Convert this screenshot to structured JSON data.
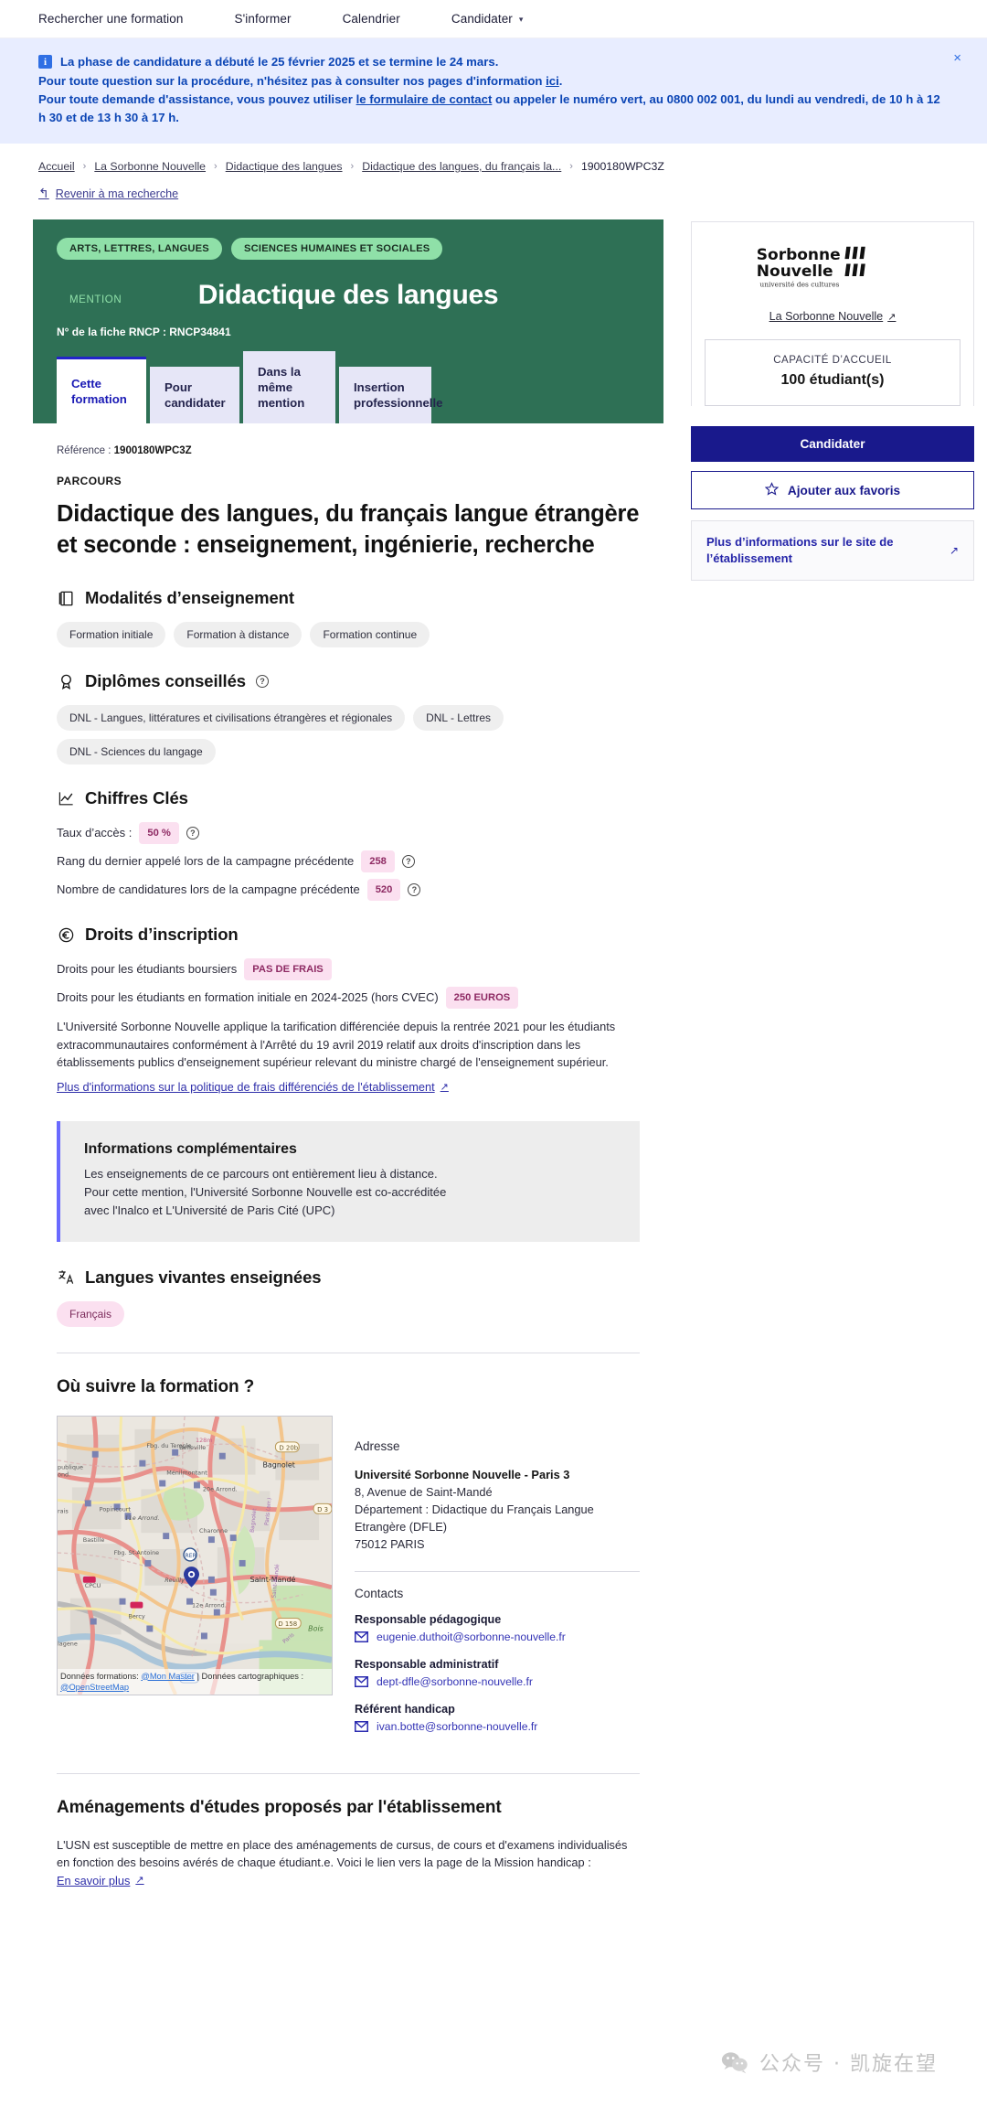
{
  "topnav": {
    "items": [
      {
        "label": "Rechercher une formation",
        "has_caret": false
      },
      {
        "label": "S'informer",
        "has_caret": false
      },
      {
        "label": "Calendrier",
        "has_caret": false
      },
      {
        "label": "Candidater",
        "has_caret": true
      }
    ]
  },
  "banner": {
    "line1": "La phase de candidature a débuté le 25 février 2025 et se termine le 24 mars.",
    "line2_before": "Pour toute question sur la procédure, n'hésitez pas à consulter nos pages d'information ",
    "line2_link": "ici",
    "line2_after": ".",
    "line3_before": "Pour toute demande d'assistance, vous pouvez utiliser ",
    "line3_link": "le formulaire de contact",
    "line3_after": " ou appeler le numéro vert, au 0800 002 001, du lundi au vendredi, de 10 h à 12 h 30 et de 13 h 30 à 17 h.",
    "close_label": "×"
  },
  "breadcrumb": {
    "items": [
      "Accueil",
      "La Sorbonne Nouvelle",
      "Didactique des langues",
      "Didactique des langues, du français la..."
    ],
    "current": "1900180WPC3Z",
    "separator": "›"
  },
  "back": {
    "label": "Revenir à ma recherche",
    "icon": "↰"
  },
  "hero": {
    "tags": [
      "ARTS, LETTRES, LANGUES",
      "SCIENCES HUMAINES ET SOCIALES"
    ],
    "mention_label": "MENTION",
    "title": "Didactique des langues",
    "rncp": "N° de la fiche RNCP : RNCP34841",
    "tabs": [
      {
        "label": "Cette formation",
        "active": true
      },
      {
        "label": "Pour candidater",
        "active": false
      },
      {
        "label": "Dans la même mention",
        "active": false
      },
      {
        "label": "Insertion professionnelle",
        "active": false
      }
    ]
  },
  "main": {
    "reference_label": "Référence : ",
    "reference_value": "1900180WPC3Z",
    "parcours_label": "PARCOURS",
    "course_title": "Didactique des langues, du français langue étrangère et seconde : enseignement, ingénierie, recherche",
    "modalites": {
      "heading": "Modalités d’enseignement",
      "chips": [
        "Formation initiale",
        "Formation à distance",
        "Formation continue"
      ]
    },
    "diplomes": {
      "heading": "Diplômes conseillés",
      "chips": [
        "DNL - Langues, littératures et civilisations étrangères et régionales",
        "DNL - Lettres",
        "DNL - Sciences du langage"
      ]
    },
    "chiffres": {
      "heading": "Chiffres Clés",
      "rows": [
        {
          "label": "Taux d’accès :",
          "value": "50 %"
        },
        {
          "label": "Rang du dernier appelé lors de la campagne précédente",
          "value": "258"
        },
        {
          "label": "Nombre de candidatures lors de la campagne précédente",
          "value": "520"
        }
      ]
    },
    "droits": {
      "heading": "Droits d’inscription",
      "rows": [
        {
          "label": "Droits pour les étudiants boursiers",
          "value": "PAS DE FRAIS"
        },
        {
          "label": "Droits pour les étudiants en formation initiale en 2024-2025 (hors CVEC)",
          "value": "250 EUROS"
        }
      ],
      "paragraph": "L'Université Sorbonne Nouvelle applique la tarification différenciée depuis la rentrée 2021 pour les étudiants extracommunautaires conformément à l'Arrêté du 19 avril 2019 relatif aux droits d'inscription dans les établissements publics d'enseignement supérieur relevant du ministre chargé de l'enseignement supérieur.",
      "link": "Plus d'informations sur la politique de frais différenciés de l'établissement"
    },
    "callout": {
      "title": "Informations complémentaires",
      "line1": "Les enseignements de ce parcours ont entièrement lieu à distance.",
      "line2": "Pour cette mention, l'Université Sorbonne Nouvelle est co-accréditée",
      "line3": "avec l'Inalco et L'Université de Paris Cité (UPC)"
    },
    "langues": {
      "heading": "Langues vivantes enseignées",
      "chips": [
        "Français"
      ]
    },
    "where": {
      "heading": "Où suivre la formation ?",
      "map_attr_prefix": "Données formations: ",
      "map_attr_link1": "@Mon Master",
      "map_attr_middle": " | Données cartographiques : ",
      "map_attr_link2": "@OpenStreetMap",
      "address_label": "Adresse",
      "address_lines": [
        "Université Sorbonne Nouvelle - Paris 3",
        "8, Avenue de Saint-Mandé",
        "Département : Didactique du Français Langue",
        "Etrangère (DFLE)",
        "75012 PARIS"
      ],
      "contacts_label": "Contacts",
      "contacts": [
        {
          "role": "Responsable pédagogique",
          "email": "eugenie.duthoit@sorbonne-nouvelle.fr"
        },
        {
          "role": "Responsable administratif",
          "email": "dept-dfle@sorbonne-nouvelle.fr"
        },
        {
          "role": "Référent handicap",
          "email": "ivan.botte@sorbonne-nouvelle.fr"
        }
      ]
    },
    "amenagements": {
      "heading": "Aménagements d'études proposés par l'établissement",
      "paragraph": "L'USN est susceptible de mettre en place des aménagements de cursus, de cours et d'examens individualisés en fonction des besoins avérés de chaque étudiant.e. Voici le lien vers la page de la Mission handicap : ",
      "link": "En savoir plus"
    }
  },
  "sidebar": {
    "logo_line1": "Sorbonne",
    "logo_line2": "Nouvelle",
    "logo_sub": "université des cultures",
    "school_link": "La Sorbonne Nouvelle",
    "capacity_label": "CAPACITÉ D’ACCUEIL",
    "capacity_value": "100 étudiant(s)",
    "apply_button": "Candidater",
    "favorite_button": "Ajouter aux favoris",
    "more_info": "Plus d’informations sur le site de l’établissement"
  },
  "watermark": {
    "text": "公众号 · 凯旋在望"
  },
  "colors": {
    "hero_green": "#2e7055",
    "tag_green": "#8fe0a8",
    "accent_blue": "#19198c",
    "banner_bg": "#e8edff",
    "banner_text": "#0b45b5",
    "pill_pink_bg": "#fbe0f0",
    "pill_pink_text": "#8e2a63",
    "callout_bar": "#6a6aff"
  }
}
